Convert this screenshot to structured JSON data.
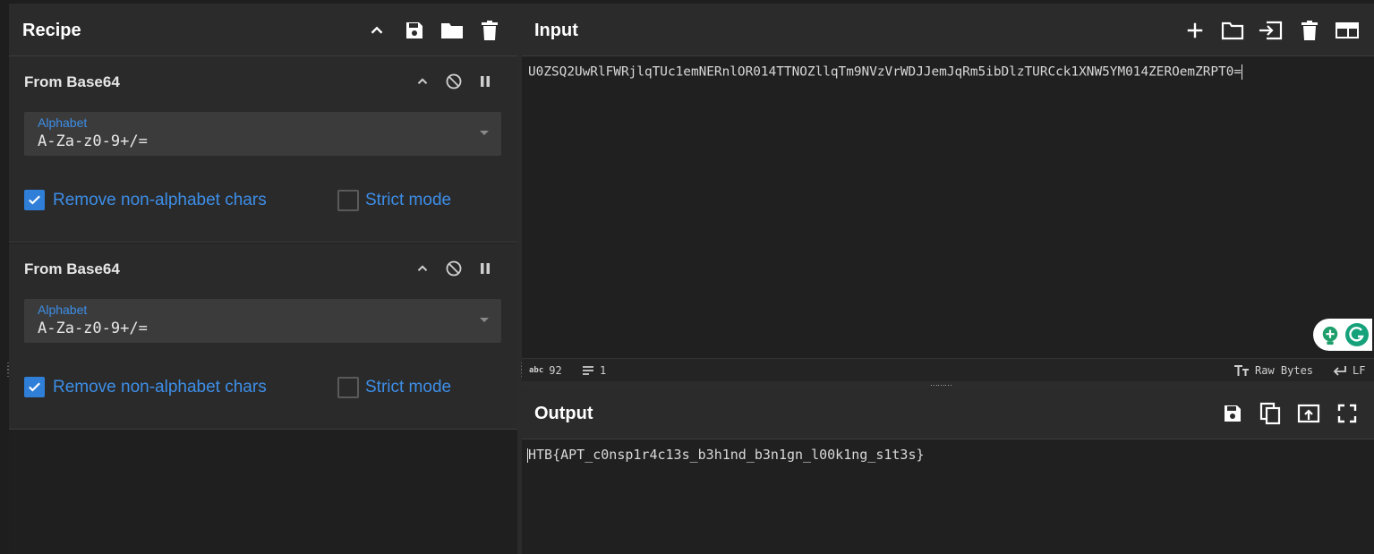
{
  "recipe": {
    "title": "Recipe",
    "operations": [
      {
        "name": "From Base64",
        "arg_label": "Alphabet",
        "arg_value": "A-Za-z0-9+/=",
        "remove_label": "Remove non-alphabet chars",
        "strict_label": "Strict mode"
      },
      {
        "name": "From Base64",
        "arg_label": "Alphabet",
        "arg_value": "A-Za-z0-9+/=",
        "remove_label": "Remove non-alphabet chars",
        "strict_label": "Strict mode"
      }
    ]
  },
  "input": {
    "title": "Input",
    "text": "U0ZSQ2UwRlFWRjlqTUc1emNERnlOR014TTNOZllqTm9NVzVrWDJJemJqRm5ibDlzTURCck1XNW5YM014ZEROemZRPT0="
  },
  "status": {
    "abc_icon": "abc",
    "length": "92",
    "lines": "1",
    "encoding": "Raw Bytes",
    "eol": "LF"
  },
  "output": {
    "title": "Output",
    "text": "HTB{APT_c0nsp1r4c13s_b3h1nd_b3n1gn_l00k1ng_s1t3s}"
  },
  "colors": {
    "accent": "#2f7ed8",
    "label_blue": "#3d8ee8",
    "panel_header": "#2b2b2b"
  }
}
